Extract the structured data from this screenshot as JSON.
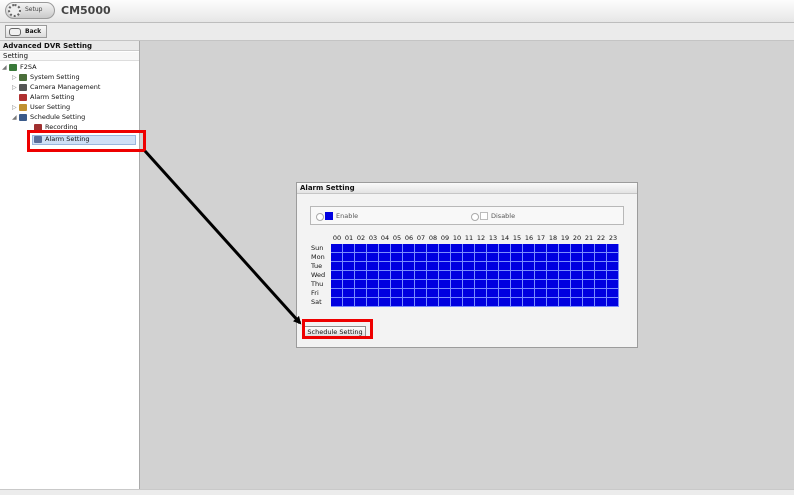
{
  "app": {
    "setup_label": "Setup",
    "title": "CM5000",
    "back_label": "Back"
  },
  "sidebar": {
    "title": "Advanced DVR Setting",
    "subtitle": "Setting",
    "tree": [
      {
        "label": "F2SA",
        "icon": "dvr-icon"
      },
      {
        "label": "System Setting",
        "icon": "system-setting-icon"
      },
      {
        "label": "Camera Management",
        "icon": "camera-icon"
      },
      {
        "label": "Alarm Setting",
        "icon": "alarm-icon"
      },
      {
        "label": "User Setting",
        "icon": "user-icon"
      },
      {
        "label": "Schedule Setting",
        "icon": "schedule-icon"
      },
      {
        "label": "Recording",
        "icon": "recording-icon"
      },
      {
        "label": "Alarm Setting",
        "icon": "schedule-alarm-icon",
        "selected": true
      }
    ]
  },
  "dialog": {
    "title": "Alarm Setting",
    "enable_label": "Enable",
    "disable_label": "Disable",
    "hours": [
      "00",
      "01",
      "02",
      "03",
      "04",
      "05",
      "06",
      "07",
      "08",
      "09",
      "10",
      "11",
      "12",
      "13",
      "14",
      "15",
      "16",
      "17",
      "18",
      "19",
      "20",
      "21",
      "22",
      "23"
    ],
    "days": [
      "Sun",
      "Mon",
      "Tue",
      "Wed",
      "Thu",
      "Fri",
      "Sat"
    ],
    "schedule_all_enabled": true,
    "schedule_button_label": "Schedule Setting"
  },
  "colors": {
    "enabled": "#0000e0",
    "highlight": "#ee0000"
  }
}
